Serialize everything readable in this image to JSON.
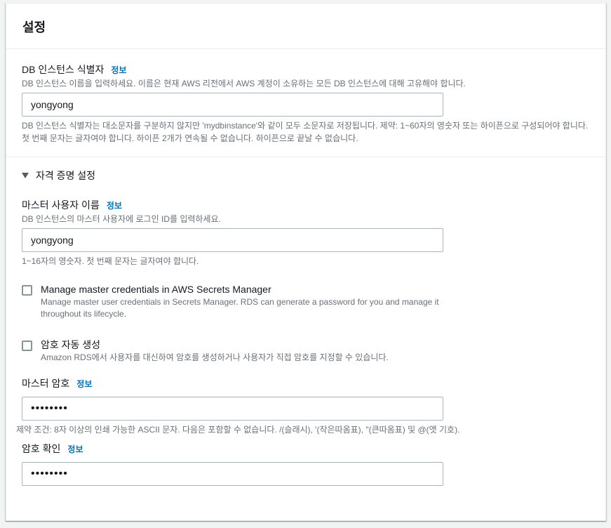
{
  "header": {
    "title": "설정"
  },
  "instance_id": {
    "label": "DB 인스턴스 식별자",
    "info": "정보",
    "description": "DB 인스턴스 이름을 입력하세요. 이름은 현재 AWS 리전에서 AWS 계정이 소유하는 모든 DB 인스턴스에 대해 고유해야 합니다.",
    "value": "yongyong",
    "constraint": "DB 인스턴스 식별자는 대소문자를 구분하지 않지만 'mydbinstance'와 같이 모두 소문자로 저장됩니다. 제약: 1~60자의 영숫자 또는 하이픈으로 구성되어야 합니다. 첫 번째 문자는 글자여야 합니다. 하이픈 2개가 연속될 수 없습니다. 하이픈으로 끝날 수 없습니다."
  },
  "credentials": {
    "section_label": "자격 증명 설정",
    "master_username": {
      "label": "마스터 사용자 이름",
      "info": "정보",
      "description": "DB 인스턴스의 마스터 사용자에 로그인 ID를 입력하세요.",
      "value": "yongyong",
      "constraint": "1~16자의 영숫자. 첫 번째 문자는 글자여야 합니다."
    },
    "secrets_manager": {
      "title": "Manage master credentials in AWS Secrets Manager",
      "description": "Manage master user credentials in Secrets Manager. RDS can generate a password for you and manage it throughout its lifecycle.",
      "checked": false
    },
    "auto_generate": {
      "title": "암호 자동 생성",
      "description": "Amazon RDS에서 사용자를 대신하여 암호를 생성하거나 사용자가 직접 암호를 지정할 수 있습니다.",
      "checked": false
    },
    "master_password": {
      "label": "마스터 암호",
      "info": "정보",
      "value": "••••••••",
      "constraint": "제약 조건: 8자 이상의 인쇄 가능한 ASCII 문자. 다음은 포함할 수 없습니다. /(슬래시), '(작은따옴표), \"(큰따옴표) 및 @(앳 기호)."
    },
    "confirm_password": {
      "label": "암호 확인",
      "info": "정보",
      "value": "••••••••"
    }
  },
  "colors": {
    "link": "#0073bb",
    "text": "#16191f",
    "muted": "#687078",
    "border": "#aab7b8"
  },
  "icons": {
    "expander": "caret-down-icon"
  }
}
